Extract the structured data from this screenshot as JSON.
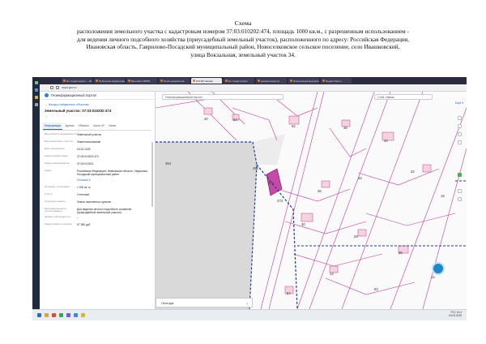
{
  "heading": {
    "line1": "Схема",
    "line2": "расположения земельного участка с кадастровым номером 37:03:010202:474, площадь 1000 кв.м., с разрешенным использованием -",
    "line3": "для ведения личного подсобного хозяйства (приусадебный земельный участок), расположенного по адресу: Российская Федерация,",
    "line4": "Ивановская область, Гаврилово-Посадский муниципальный район, Новоселковское сельское поселение, село Ивашковский,",
    "line5": "улица Вокзальная, земельный участок 34."
  },
  "browser": {
    "tabs": [
      "Ел. Кадастровая — №",
      "Публичная кадастровая",
      "Вконтакте ВКРМ",
      "Поиск документов",
      "НСПД Главная",
      "Ел. Кадастровая",
      "документация ф",
      "Электронный документ",
      "Яндекс Карты"
    ],
    "active_tab_index": 4,
    "url": "nspd.gov.ru"
  },
  "panel": {
    "brand": "Геоинформационный портал",
    "back_link": "← Назад к найденным объектам",
    "object_title": "Земельный участок: 37:03:010202:474",
    "star": "☆",
    "tabs": [
      "Информация",
      "Здания",
      "Объекты",
      "Части ЗУ",
      "Связи"
    ],
    "attributes": [
      {
        "k": "Вид объекта недвижимости",
        "v": "Земельный участок",
        "link": false
      },
      {
        "k": "Вид земельного участка",
        "v": "Землепользование",
        "link": false
      },
      {
        "k": "Дата присвоения",
        "v": "04.02.2025",
        "link": false
      },
      {
        "k": "Кадастровый номер",
        "v": "37:03:010202:474",
        "link": false
      },
      {
        "k": "Кадастровый квартал",
        "v": "37:03:010202",
        "link": false
      },
      {
        "k": "Адрес",
        "v": "Российская Федерация, Ивановская область, Гаврилово-Посадский муниципальный район",
        "link": false
      },
      {
        "k": "",
        "v": "Показать ▾",
        "link": true
      },
      {
        "k": "Площадь уточненная",
        "v": "1 000 кв. м",
        "link": false
      },
      {
        "k": "Статус",
        "v": "Учтенный",
        "link": false
      },
      {
        "k": "Категория земель",
        "v": "Земли населенных пунктов",
        "link": false
      },
      {
        "k": "Вид разрешенного использования",
        "v": "Для ведения личного подсобного хозяйства (приусадебный земельный участок)",
        "link": false
      },
      {
        "k": "Форма собственности",
        "v": "–",
        "link": false
      },
      {
        "k": "Кадастровая стоимость",
        "v": "97 380 руб",
        "link": false
      }
    ]
  },
  "map": {
    "search_placeholder": "Геоинформационный портал",
    "search2": "Слой. Ивашк.",
    "more": "Ещё ▾",
    "legend": "Легенда",
    "legend_chevron": "⌄",
    "parcel_labels": [
      "354",
      "40",
      "62",
      "44",
      "38",
      "474",
      "36",
      "34",
      "32",
      "30",
      "28",
      "26",
      "18",
      "14",
      "12",
      "53",
      "452",
      "473",
      "57",
      "63"
    ]
  },
  "taskbar": {
    "tray_line1": "РУС 13:4",
    "tray_line2": "04.03.2025"
  }
}
